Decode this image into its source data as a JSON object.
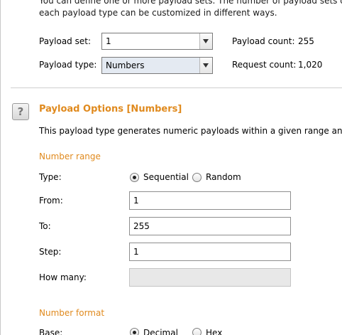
{
  "intro": {
    "line1": "You can define one or more payload sets. The number of payload sets dep",
    "line2": "each payload type can be customized in different ways."
  },
  "payload_set": {
    "label": "Payload set:",
    "value": "1"
  },
  "payload_type": {
    "label": "Payload type:",
    "value": "Numbers"
  },
  "payload_count": {
    "label": "Payload count:",
    "value": "255"
  },
  "request_count": {
    "label": "Request count:",
    "value": "1,020"
  },
  "options": {
    "help_glyph": "?",
    "title": "Payload Options [Numbers]",
    "description": "This payload type generates numeric payloads within a given range and in"
  },
  "number_range": {
    "heading": "Number range",
    "type_label": "Type:",
    "sequential_label": "Sequential",
    "random_label": "Random",
    "selected": "Sequential",
    "from_label": "From:",
    "from_value": "1",
    "to_label": "To:",
    "to_value": "255",
    "step_label": "Step:",
    "step_value": "1",
    "how_many_label": "How many:",
    "how_many_value": ""
  },
  "number_format": {
    "heading": "Number format",
    "base_label": "Base:",
    "decimal_label": "Decimal",
    "hex_label": "Hex",
    "selected": "Decimal"
  },
  "colors": {
    "accent": "#e08a1e",
    "combo_selected_bg": "#e4eaf2"
  }
}
